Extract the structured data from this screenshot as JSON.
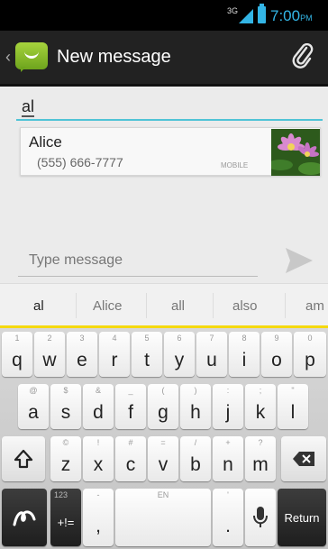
{
  "status_bar": {
    "network": "3G",
    "time": "7:00",
    "ampm": "PM",
    "accent_color": "#33b5e5"
  },
  "action_bar": {
    "back_icon": "chevron-left-icon",
    "app_icon": "messaging-icon",
    "title": "New message",
    "attach_icon": "paperclip-icon"
  },
  "recipient": {
    "value": "al"
  },
  "suggestion": {
    "name": "Alice",
    "phone": "(555) 666-7777",
    "type": "MOBILE"
  },
  "compose": {
    "placeholder": "Type message",
    "send_icon": "send-icon"
  },
  "word_suggestions": [
    "al",
    "Alice",
    "all",
    "also",
    "am"
  ],
  "keyboard": {
    "row1": [
      {
        "main": "q",
        "alt": "1"
      },
      {
        "main": "w",
        "alt": "2"
      },
      {
        "main": "e",
        "alt": "3"
      },
      {
        "main": "r",
        "alt": "4"
      },
      {
        "main": "t",
        "alt": "5"
      },
      {
        "main": "y",
        "alt": "6"
      },
      {
        "main": "u",
        "alt": "7"
      },
      {
        "main": "i",
        "alt": "8"
      },
      {
        "main": "o",
        "alt": "9"
      },
      {
        "main": "p",
        "alt": "0"
      }
    ],
    "row2": [
      {
        "main": "a",
        "alt": "@"
      },
      {
        "main": "s",
        "alt": "$"
      },
      {
        "main": "d",
        "alt": "&"
      },
      {
        "main": "f",
        "alt": "_"
      },
      {
        "main": "g",
        "alt": "("
      },
      {
        "main": "h",
        "alt": ")"
      },
      {
        "main": "j",
        "alt": ":"
      },
      {
        "main": "k",
        "alt": ";"
      },
      {
        "main": "l",
        "alt": "\""
      }
    ],
    "row3": [
      {
        "main": "z",
        "alt": "©"
      },
      {
        "main": "x",
        "alt": "!"
      },
      {
        "main": "c",
        "alt": "#"
      },
      {
        "main": "v",
        "alt": "="
      },
      {
        "main": "b",
        "alt": "/"
      },
      {
        "main": "n",
        "alt": "+"
      },
      {
        "main": "m",
        "alt": "?"
      }
    ],
    "symbols_main": "+!=",
    "symbols_alt": "123",
    "comma": ",",
    "comma_alt": "-",
    "space_alt": "EN",
    "period": ".",
    "period_alt": "'",
    "return_label": "Return",
    "shift_icon": "shift-icon",
    "delete_icon": "backspace-icon",
    "swype_icon": "swype-icon",
    "mic_icon": "microphone-icon"
  }
}
